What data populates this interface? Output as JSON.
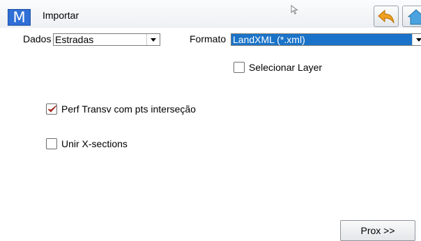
{
  "titlebar": {
    "logo": "M",
    "title": "Importar",
    "back_icon": "back-arrow-icon",
    "home_icon": "home-icon"
  },
  "form": {
    "dados_label": "Dados",
    "dados_value": "Estradas",
    "formato_label": "Formato",
    "formato_value": "LandXML (*.xml)",
    "selecionar_layer": {
      "label": "Selecionar Layer",
      "checked": false
    },
    "perf_transv": {
      "label": "Perf Transv com pts interseção",
      "checked": true
    },
    "unir_xsections": {
      "label": "Unir X-sections",
      "checked": false
    }
  },
  "footer": {
    "next_label": "Prox >>"
  },
  "colors": {
    "accent": "#2f6fd6",
    "select_highlight": "#1a73c8",
    "check_mark": "#c0392b",
    "back_arrow": "#f0a020",
    "home": "#4aa3df"
  }
}
